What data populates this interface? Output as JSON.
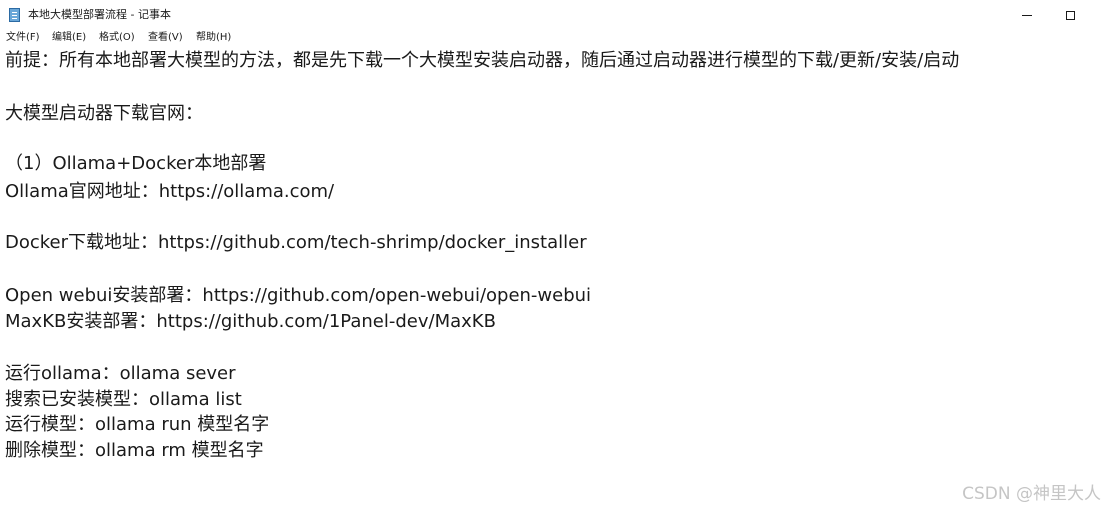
{
  "window": {
    "title": "本地大模型部署流程 - 记事本"
  },
  "menu": {
    "file": "文件(F)",
    "edit": "编辑(E)",
    "format": "格式(O)",
    "view": "查看(V)",
    "help": "帮助(H)"
  },
  "editor": {
    "line1": "前提：所有本地部署大模型的方法，都是先下载一个大模型安装启动器，随后通过启动器进行模型的下载/更新/安装/启动",
    "line3": "大模型启动器下载官网：",
    "line5": "（1）Ollama+Docker本地部署",
    "line6": "Ollama官网地址：https://ollama.com/",
    "line8": "Docker下载地址：https://github.com/tech-shrimp/docker_installer",
    "line10": "Open webui安装部署：https://github.com/open-webui/open-webui",
    "line11": "MaxKB安装部署：https://github.com/1Panel-dev/MaxKB",
    "line13": "运行ollama：ollama sever",
    "line14": "搜索已安装模型：ollama list",
    "line15": "运行模型：ollama run 模型名字",
    "line16": " 删除模型：ollama rm 模型名字"
  },
  "watermark": "CSDN @神里大人",
  "icons": {
    "app": "notepad-icon",
    "minimize": "minimize-icon",
    "maximize": "maximize-icon"
  }
}
